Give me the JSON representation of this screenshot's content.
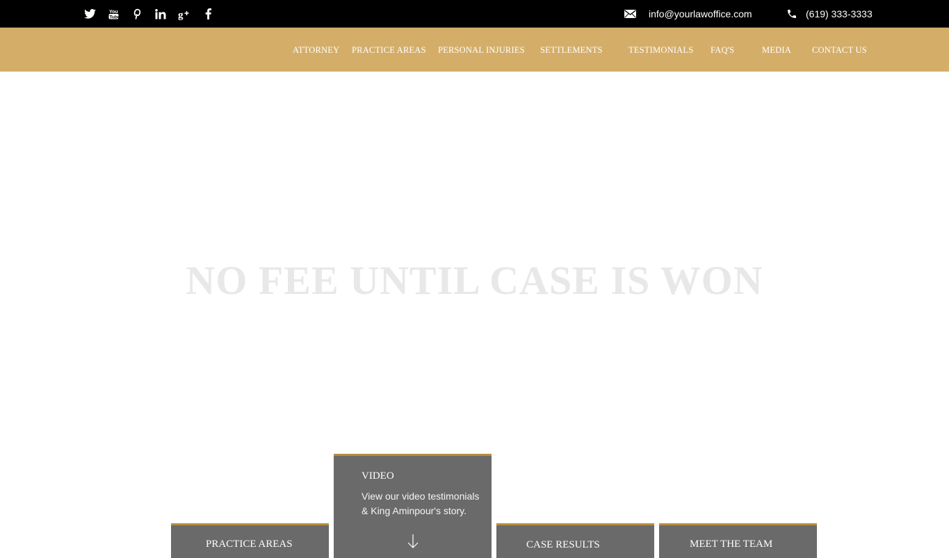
{
  "topbar": {
    "social": [
      {
        "name": "twitter-icon"
      },
      {
        "name": "youtube-icon"
      },
      {
        "name": "pinterest-icon"
      },
      {
        "name": "linkedin-icon"
      },
      {
        "name": "google-plus-icon"
      },
      {
        "name": "facebook-icon"
      }
    ],
    "email": "info@yourlawoffice.com",
    "phone": "(619) 333-3333"
  },
  "nav": {
    "items": [
      "ATTORNEY",
      "PRACTICE AREAS",
      "PERSONAL INJURIES",
      "SETTLEMENTS",
      "TESTIMONIALS",
      "FAQ'S",
      "MEDIA",
      "CONTACT US"
    ]
  },
  "hero": {
    "title": "NO FEE UNTIL CASE IS WON"
  },
  "tiles": {
    "practice": {
      "label": "PRACTICE AREAS"
    },
    "video": {
      "label": "VIDEO",
      "description": "View our video testimonials & King Aminpour's story."
    },
    "results": {
      "label": "CASE RESULTS"
    },
    "team": {
      "label": "MEET THE TEAM"
    }
  },
  "colors": {
    "topbar": "#000000",
    "nav": "#d4ae69",
    "tile": "#6a6a6a",
    "tile_accent": "#b88f3e",
    "hero_text": "#e8e8e8"
  }
}
